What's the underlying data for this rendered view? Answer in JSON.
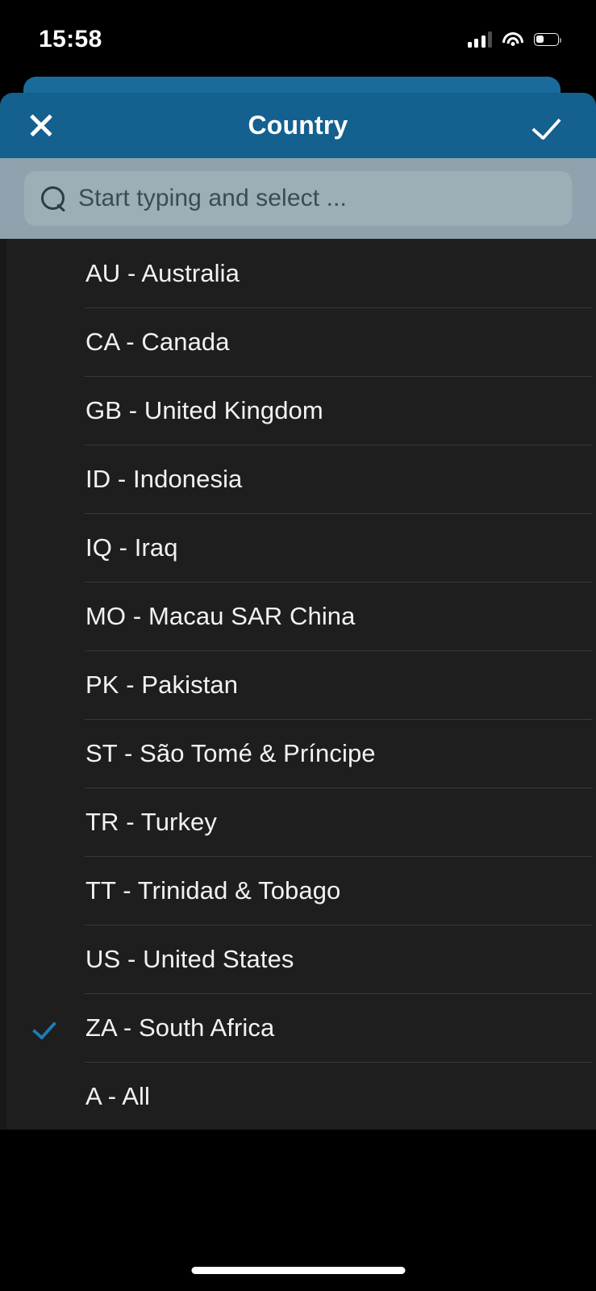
{
  "status_bar": {
    "time": "15:58",
    "signal_icon": "cellular-signal-icon",
    "signal_bars_filled": 3,
    "signal_bars_total": 4,
    "wifi_icon": "wifi-icon",
    "battery_icon": "battery-icon",
    "battery_level_percent": 35
  },
  "header": {
    "title": "Country",
    "close_icon": "close-icon",
    "confirm_icon": "check-icon",
    "background_color": "#14608f",
    "back_card_color": "#1a6b9c"
  },
  "search": {
    "placeholder": "Start typing and select ...",
    "value": "",
    "icon": "search-icon",
    "bar_background_color": "#8fa2ad"
  },
  "list": {
    "selected_color": "#1f7cb4",
    "background_color": "#1e1e1e",
    "options": [
      {
        "label": "AU - Australia",
        "selected": false
      },
      {
        "label": "CA - Canada",
        "selected": false
      },
      {
        "label": "GB - United Kingdom",
        "selected": false
      },
      {
        "label": "ID - Indonesia",
        "selected": false
      },
      {
        "label": "IQ - Iraq",
        "selected": false
      },
      {
        "label": "MO - Macau SAR China",
        "selected": false
      },
      {
        "label": "PK - Pakistan",
        "selected": false
      },
      {
        "label": "ST - São Tomé & Príncipe",
        "selected": false
      },
      {
        "label": "TR - Turkey",
        "selected": false
      },
      {
        "label": "TT - Trinidad & Tobago",
        "selected": false
      },
      {
        "label": "US - United States",
        "selected": false
      },
      {
        "label": "ZA - South Africa",
        "selected": true
      },
      {
        "label": "A - All",
        "selected": false
      }
    ]
  },
  "home_indicator": {
    "name": "home-indicator"
  }
}
